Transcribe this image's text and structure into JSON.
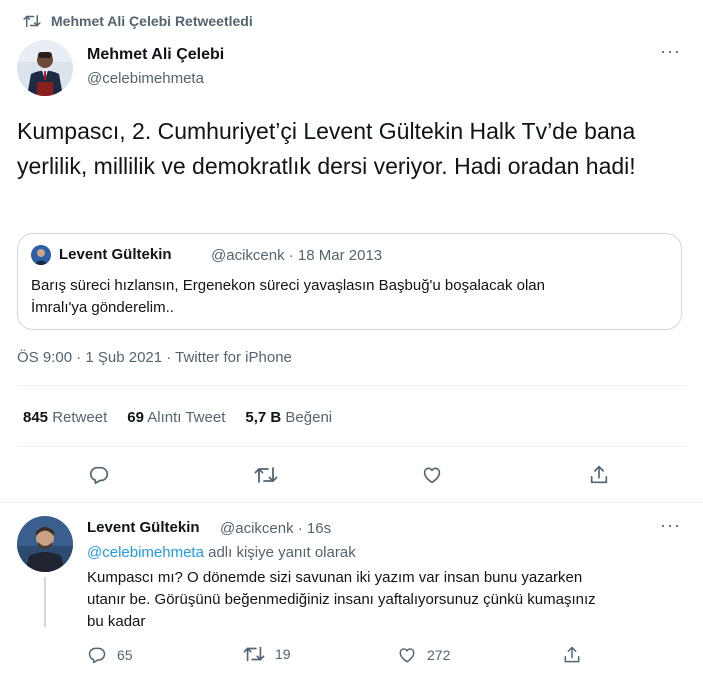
{
  "retweet_header": {
    "label": "Mehmet Ali Çelebi Retweetledi"
  },
  "main_tweet": {
    "author_name": "Mehmet Ali Çelebi",
    "author_handle": "@celebimehmeta",
    "more_label": "···",
    "text": "Kumpascı, 2. Cumhuriyet’çi Levent Gültekin Halk Tv’de bana yerlilik, millilik ve demokratlık dersi veriyor. Hadi oradan hadi!",
    "timestamp": "ÖS 9:00 · 1 Şub 2021 · Twitter for iPhone"
  },
  "quoted_tweet": {
    "author_name": "Levent Gültekin",
    "meta": "@acikcenk · 18 Mar 2013",
    "text_line1": "Barış süreci hızlansın, Ergenekon süreci yavaşlasın Başbuğ'u boşalacak olan",
    "text_line2": "İmralı'ya gönderelim.."
  },
  "stats": {
    "retweet_count": "845",
    "retweet_label": "Retweet",
    "quote_count": "69",
    "quote_label": "Alıntı Tweet",
    "like_count": "5,7 B",
    "like_label": "Beğeni"
  },
  "reply": {
    "author_name": "Levent Gültekin",
    "meta": "@acikcenk · 16s",
    "more_label": "···",
    "reply_to_handle": "@celebimehmeta",
    "reply_to_suffix": " adlı kişiye yanıt olarak",
    "text_line1": "Kumpascı mı? O dönemde sizi savunan iki yazım var insan bunu yazarken",
    "text_line2": "utanır be. Görüşünü beğenmediğiniz insanı yaftalıyorsunuz çünkü kumaşınız",
    "text_line3": "bu kadar",
    "reply_count": "65",
    "retweet_count": "19",
    "like_count": "272"
  },
  "colors": {
    "text": "#0f1419",
    "muted": "#536471",
    "link": "#1d9bf0",
    "border": "#cfd9de",
    "divider": "#eff3f4"
  },
  "icons": {
    "retweet": "retweet-icon",
    "reply": "reply-icon",
    "like": "heart-icon",
    "share": "share-icon",
    "more": "more-icon"
  }
}
